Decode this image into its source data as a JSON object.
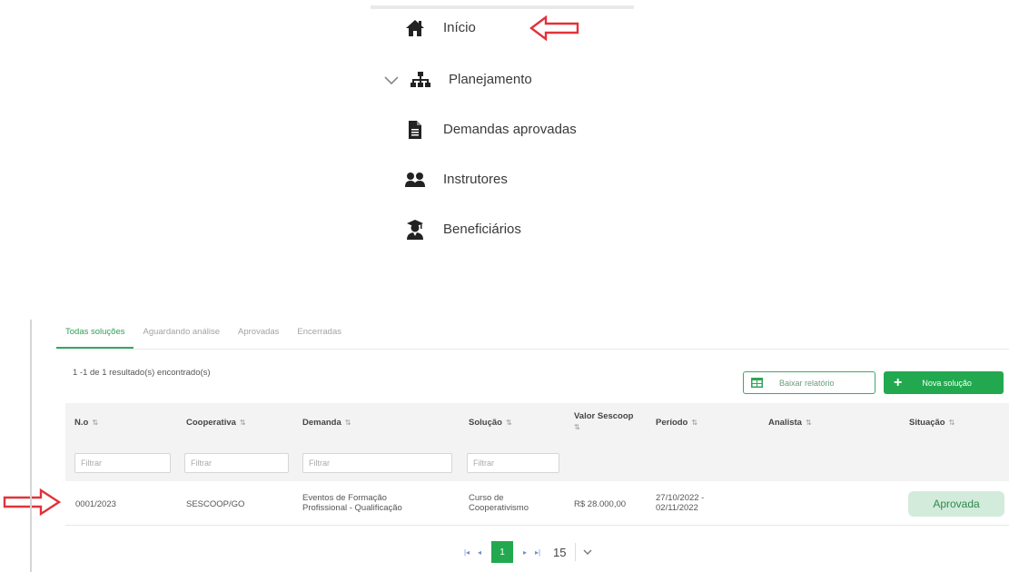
{
  "menu": {
    "items": [
      {
        "label": "Início",
        "icon": "home-icon"
      },
      {
        "label": "Planejamento",
        "icon": "sitemap-icon"
      },
      {
        "label": "Demandas aprovadas",
        "icon": "document-icon"
      },
      {
        "label": "Instrutores",
        "icon": "users-icon"
      },
      {
        "label": "Beneficiários",
        "icon": "graduate-icon"
      }
    ]
  },
  "tabs": [
    {
      "label": "Todas soluções",
      "active": true
    },
    {
      "label": "Aguardando análise",
      "active": false
    },
    {
      "label": "Aprovadas",
      "active": false
    },
    {
      "label": "Encerradas",
      "active": false
    }
  ],
  "results": {
    "count_text": "1 -1 de 1 resultado(s) encontrado(s)"
  },
  "toolbar": {
    "report_label": "Baixar relatório",
    "new_label": "Nova solução"
  },
  "table": {
    "columns": [
      "N.o",
      "Cooperativa",
      "Demanda",
      "Solução",
      "Valor Sescoop",
      "Período",
      "Analista",
      "Situação"
    ],
    "filter_placeholder": "Filtrar",
    "rows": [
      {
        "numero": "0001/2023",
        "cooperativa": "SESCOOP/GO",
        "demanda_l1": "Eventos de Formação",
        "demanda_l2": "Profissional - Qualificação",
        "solucao_l1": "Curso de",
        "solucao_l2": "Cooperativismo",
        "valor": "R$ 28.000,00",
        "periodo_l1": "27/10/2022 -",
        "periodo_l2": "02/11/2022",
        "analista": "",
        "situacao": "Aprovada"
      }
    ]
  },
  "pagination": {
    "current": "1",
    "page_size": "15"
  },
  "colors": {
    "accent": "#22a94f",
    "badge_bg": "#d3ebdb",
    "arrow": "#e2323a"
  }
}
